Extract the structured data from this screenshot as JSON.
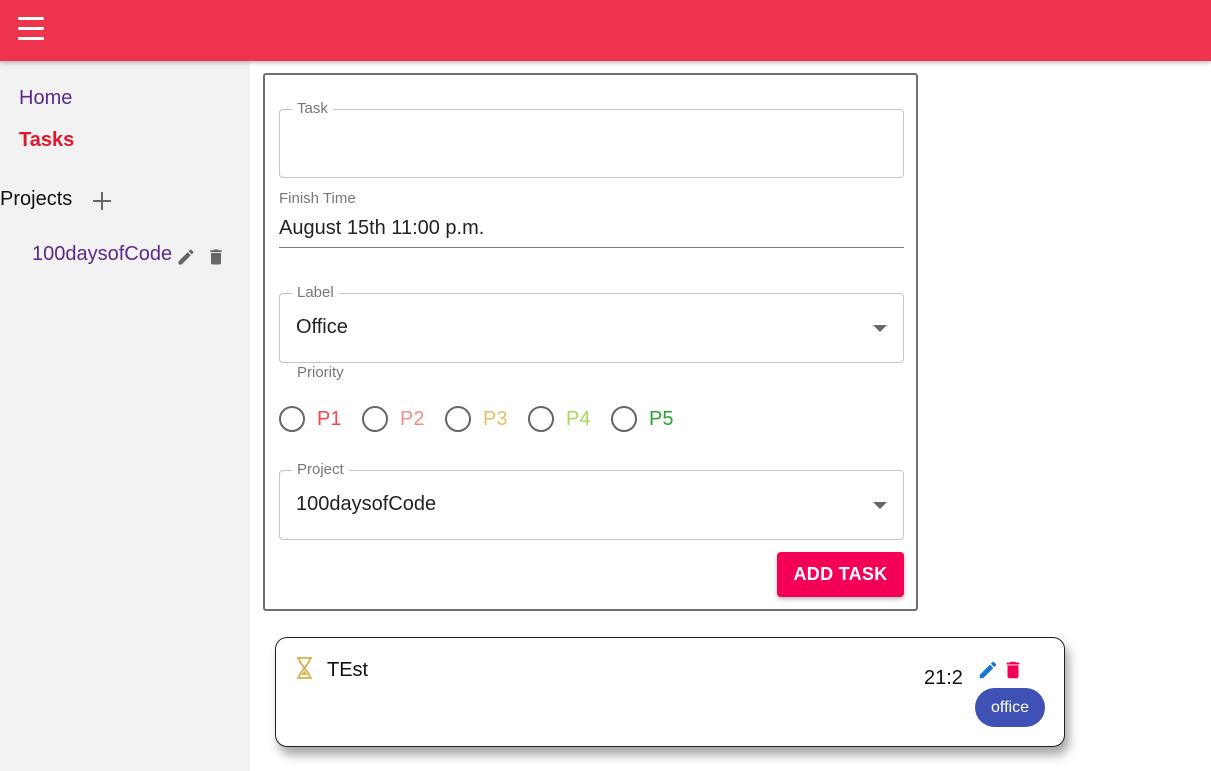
{
  "appbar": {
    "menu_icon": "hamburger-menu-icon",
    "color": "#ee334c"
  },
  "sidebar": {
    "nav": [
      {
        "label": "Home",
        "color": "#5a2a8a"
      },
      {
        "label": "Tasks",
        "color": "#e0162b"
      }
    ],
    "projects_title": "Projects",
    "add_icon": "plus-icon",
    "projects": [
      {
        "label": "100daysofCode",
        "edit_icon": "pencil-icon",
        "delete_icon": "trash-icon"
      }
    ]
  },
  "form": {
    "task": {
      "legend": "Task",
      "value": ""
    },
    "finish_time": {
      "label": "Finish Time",
      "value": "August 15th 11:00 p.m."
    },
    "label": {
      "legend": "Label",
      "value": "Office"
    },
    "priority": {
      "label": "Priority",
      "options": [
        {
          "label": "P1",
          "color": "#f0474f"
        },
        {
          "label": "P2",
          "color": "#f08e8a"
        },
        {
          "label": "P3",
          "color": "#e3c060"
        },
        {
          "label": "P4",
          "color": "#a6d85a"
        },
        {
          "label": "P5",
          "color": "#2ba52b"
        }
      ]
    },
    "project": {
      "legend": "Project",
      "value": "100daysofCode"
    },
    "submit_label": "ADD TASK",
    "submit_color": "#f50057"
  },
  "tasks": [
    {
      "icon": "hourglass-icon",
      "name": "TEst",
      "time": "21:2",
      "edit_icon": "pencil-icon",
      "delete_icon": "trash-icon",
      "tag": "office",
      "tag_color": "#3f51b5"
    }
  ]
}
